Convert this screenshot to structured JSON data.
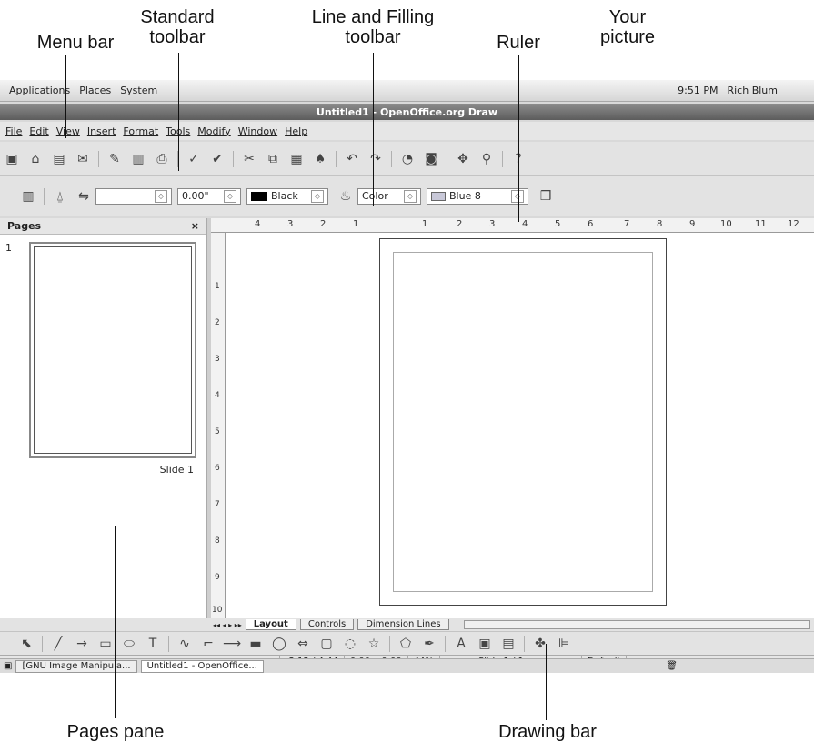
{
  "callouts": {
    "menu_bar": "Menu bar",
    "standard_toolbar_l1": "Standard",
    "standard_toolbar_l2": "toolbar",
    "line_fill_l1": "Line and Filling",
    "line_fill_l2": "toolbar",
    "ruler": "Ruler",
    "your_picture_l1": "Your",
    "your_picture_l2": "picture",
    "pages_pane": "Pages pane",
    "drawing_bar": "Drawing bar"
  },
  "panel": {
    "applications": "Applications",
    "places": "Places",
    "system": "System",
    "time": "9:51 PM",
    "user": "Rich Blum"
  },
  "window": {
    "title": "Untitled1 - OpenOffice.org Draw"
  },
  "menu": [
    "File",
    "Edit",
    "View",
    "Insert",
    "Format",
    "Tools",
    "Modify",
    "Window",
    "Help"
  ],
  "line_fill": {
    "line_width": "0.00\"",
    "line_color": "Black",
    "area_style": "Color",
    "area_color": "Blue 8"
  },
  "pages_pane": {
    "title": "Pages",
    "close": "×",
    "slide_number": "1",
    "slide_label": "Slide 1"
  },
  "ruler": {
    "h_ticks": [
      "4",
      "3",
      "2",
      "1",
      "1",
      "2",
      "3",
      "4",
      "5",
      "6",
      "7",
      "8",
      "9",
      "10",
      "11",
      "12"
    ],
    "v_ticks": [
      "1",
      "2",
      "3",
      "4",
      "5",
      "6",
      "7",
      "8",
      "9",
      "10"
    ]
  },
  "tabs": [
    "Layout",
    "Controls",
    "Dimension Lines"
  ],
  "status": {
    "position": "-2.12 / 4.44",
    "size": "0.00 x 0.00",
    "zoom": "44%",
    "slide": "Slide 1 / 1",
    "layout": "Default"
  },
  "taskbar": {
    "gimp": "[GNU Image Manipula...",
    "ooo": "Untitled1 - OpenOffice..."
  }
}
